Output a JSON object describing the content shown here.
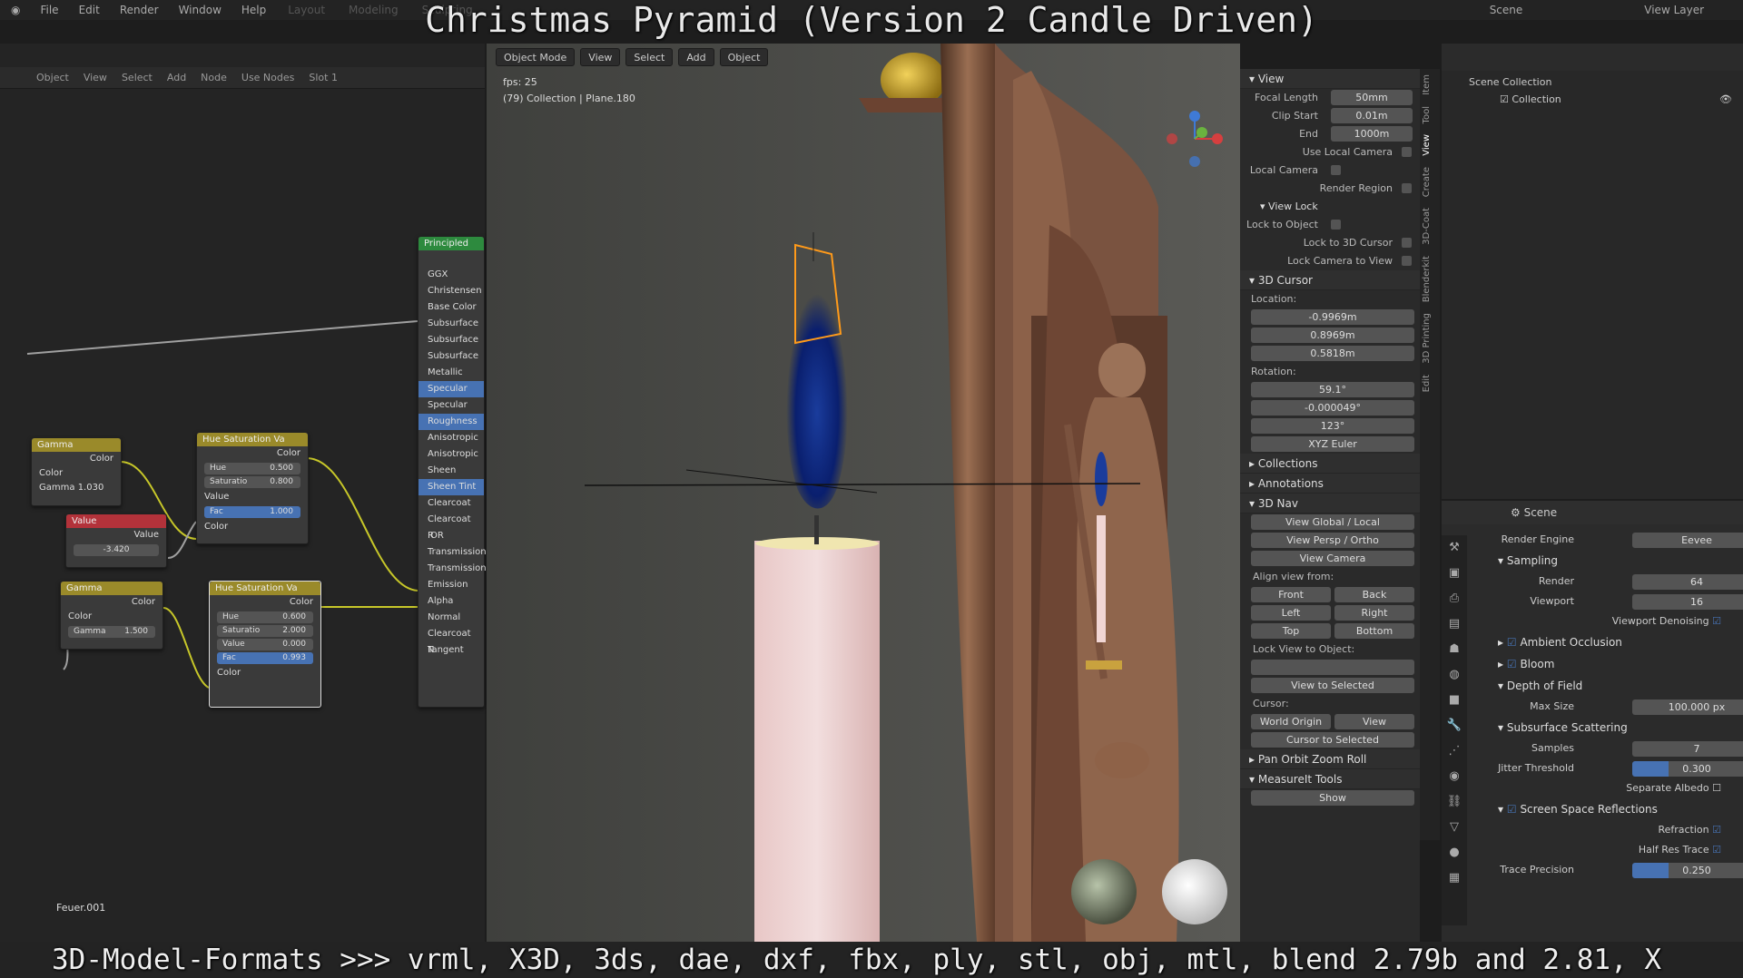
{
  "overlay": {
    "title": "Christmas Pyramid (Version 2 Candle Driven)",
    "bottom": "3D-Model-Formats >>> vrml, X3D, 3ds, dae, dxf, fbx, ply, stl, obj, mtl, blend 2.79b and 2.81, X"
  },
  "topbar": {
    "menus": [
      "File",
      "Edit",
      "Render",
      "Window",
      "Help"
    ],
    "workspaces": [
      "Layout",
      "Modeling",
      "Sculpting"
    ],
    "scene": "Scene",
    "view_layer": "View Layer"
  },
  "node_editor": {
    "header": [
      "Object",
      "View",
      "Select",
      "Add",
      "Node",
      "Use Nodes",
      "Slot 1"
    ],
    "principled": {
      "title": "Principled",
      "rows": [
        "GGX",
        "Christensen",
        "Base Color",
        "Subsurface",
        "Subsurface",
        "Subsurface",
        "Metallic",
        "Specular",
        "Specular Ti",
        "Roughness",
        "Anisotropic",
        "Anisotropic",
        "Sheen",
        "Sheen Tint",
        "Clearcoat",
        "Clearcoat R",
        "IOR",
        "Transmission",
        "Transmission",
        "Emission",
        "Alpha",
        "Normal",
        "Clearcoat N",
        "Tangent"
      ]
    },
    "gamma1": {
      "title": "Gamma",
      "out": "Color",
      "in": "Color",
      "gamma_label": "Gamma",
      "gamma_val": "1.030"
    },
    "value": {
      "title": "Value",
      "out": "Value",
      "val": "-3.420"
    },
    "gamma2": {
      "title": "Gamma",
      "out": "Color",
      "in": "Color",
      "gamma_label": "Gamma",
      "gamma_val": "1.500"
    },
    "hsv1": {
      "title": "Hue Saturation Va",
      "out": "Color",
      "hue": "Hue",
      "hue_v": "0.500",
      "sat": "Saturatio",
      "sat_v": "0.800",
      "val": "Value",
      "fac": "Fac",
      "fac_v": "1.000",
      "color": "Color"
    },
    "hsv2": {
      "title": "Hue Saturation Va",
      "out": "Color",
      "hue": "Hue",
      "hue_v": "0.600",
      "sat": "Saturatio",
      "sat_v": "2.000",
      "val": "Value",
      "val_v": "0.000",
      "fac": "Fac",
      "fac_v": "0.993",
      "color": "Color"
    },
    "material_name": "Feuer.001"
  },
  "viewport": {
    "mode": "Object Mode",
    "menus": [
      "View",
      "Select",
      "Add",
      "Object"
    ],
    "fps": "fps: 25",
    "info": "(79) Collection | Plane.180"
  },
  "n_panel": {
    "view_title": "View",
    "focal_label": "Focal Length",
    "focal": "50mm",
    "clip_start_label": "Clip Start",
    "clip_start": "0.01m",
    "end_label": "End",
    "end": "1000m",
    "use_local_camera": "Use Local Camera",
    "local_camera": "Local Camera",
    "render_region": "Render Region",
    "view_lock": "View Lock",
    "lock_obj": "Lock to Object",
    "lock_cursor": "Lock to 3D Cursor",
    "lock_cam": "Lock Camera to View",
    "cursor_title": "3D Cursor",
    "location": "Location:",
    "x": "-0.9969m",
    "y": "0.8969m",
    "z": "0.5818m",
    "rotation": "Rotation:",
    "rx": "59.1°",
    "ry": "-0.000049°",
    "rz": "123°",
    "euler": "XYZ Euler",
    "collections": "Collections",
    "annotations": "Annotations",
    "nav": "3D Nav",
    "global_local": "View Global / Local",
    "persp_ortho": "View Persp / Ortho",
    "camera": "View Camera",
    "align_from": "Align view from:",
    "front": "Front",
    "back": "Back",
    "left": "Left",
    "right": "Right",
    "top": "Top",
    "bottom": "Bottom",
    "lock_view": "Lock View to Object:",
    "view_sel": "View to Selected",
    "cursor": "Cursor:",
    "world_origin": "World Origin",
    "view": "View",
    "cursor_sel": "Cursor to Selected",
    "pan_orbit": "Pan Orbit Zoom Roll",
    "measureit": "MeasureIt Tools",
    "show": "Show",
    "tabs": [
      "Item",
      "Tool",
      "View",
      "Create",
      "3D-Coat",
      "Blenderkit",
      "3D Printing",
      "Edit"
    ]
  },
  "outliner": {
    "root": "Scene Collection",
    "collection": "Collection"
  },
  "properties": {
    "scene": "Scene",
    "engine_label": "Render Engine",
    "engine": "Eevee",
    "sampling": "Sampling",
    "render_label": "Render",
    "render": "64",
    "viewport_label": "Viewport",
    "viewport": "16",
    "denoise": "Viewport Denoising",
    "ao": "Ambient Occlusion",
    "bloom": "Bloom",
    "dof": "Depth of Field",
    "max_size_label": "Max Size",
    "max_size": "100.000 px",
    "sss": "Subsurface Scattering",
    "samples_label": "Samples",
    "samples": "7",
    "jitter_label": "Jitter Threshold",
    "jitter": "0.300",
    "jitter_fill": 0.3,
    "sep_albedo": "Separate Albedo",
    "ssr": "Screen Space Reflections",
    "refraction": "Refraction",
    "half_res": "Half Res Trace",
    "trace_label": "Trace Precision",
    "trace": "0.250",
    "trace_fill": 0.25
  },
  "colors": {
    "accent": "#4772b3",
    "header_green": "#2d8a3e",
    "gamma_header": "#9a8a2a",
    "value_header": "#b3323a"
  }
}
